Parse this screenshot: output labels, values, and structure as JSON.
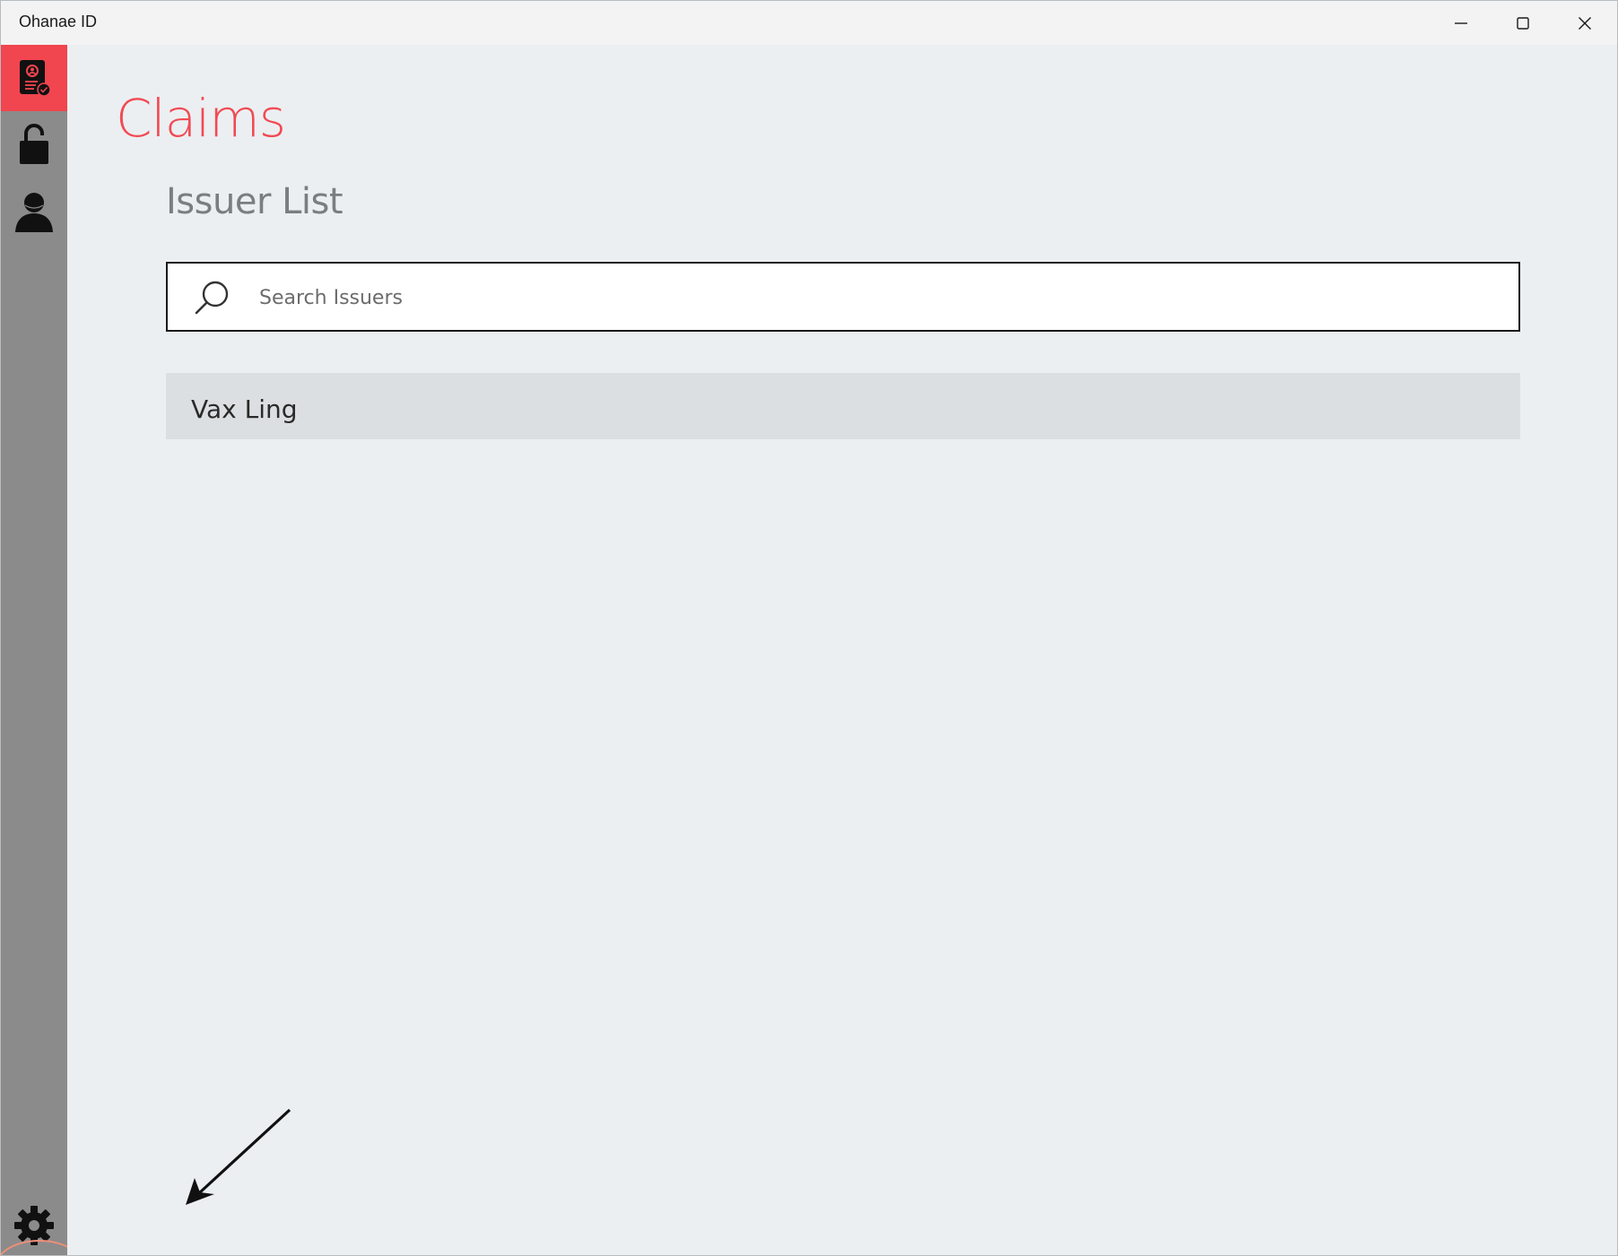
{
  "window": {
    "title": "Ohanae ID",
    "controls": {
      "minimize_icon": "minimize-icon",
      "maximize_icon": "maximize-icon",
      "close_icon": "close-icon"
    }
  },
  "sidebar": {
    "items": [
      {
        "id": "claims",
        "icon": "claims-document-icon",
        "active": true
      },
      {
        "id": "lock",
        "icon": "unlock-icon",
        "active": false
      },
      {
        "id": "profile",
        "icon": "person-icon",
        "active": false
      }
    ],
    "settings_icon": "gear-icon"
  },
  "main": {
    "page_title": "Claims",
    "section_title": "Issuer List",
    "search": {
      "placeholder": "Search Issuers",
      "value": ""
    },
    "issuers": [
      {
        "name": "Vax Ling"
      }
    ]
  },
  "colors": {
    "accent": "#f1454f",
    "sidebar": "#8b8b8b",
    "background": "#eceff1",
    "list_item": "#dcdfe1",
    "annotation_ring": "#ef8f78"
  }
}
